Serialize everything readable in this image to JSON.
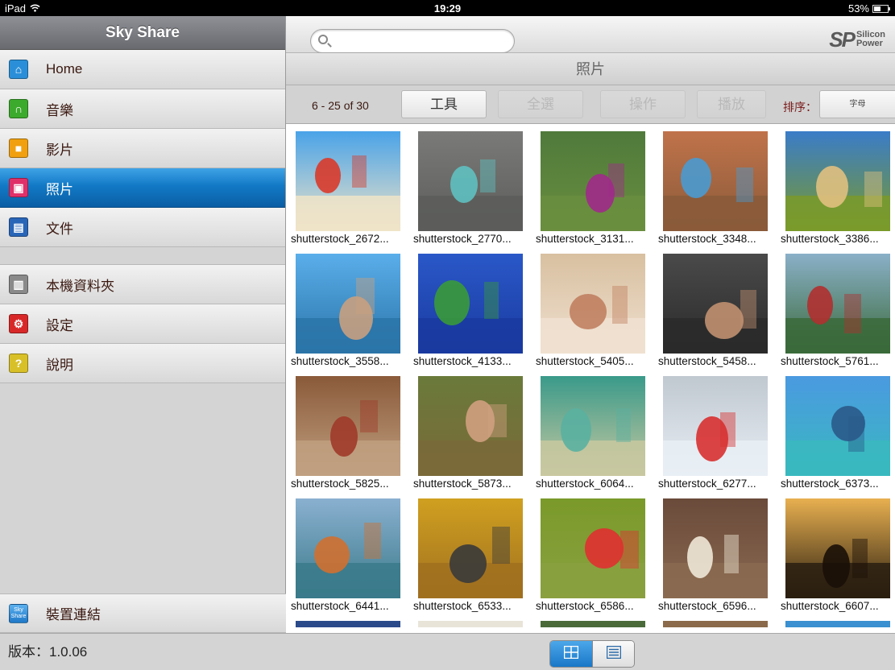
{
  "status_bar": {
    "device": "iPad",
    "time": "19:29",
    "battery": "53%",
    "battery_level": 0.53
  },
  "sidebar": {
    "title": "Sky Share",
    "items": [
      {
        "label": "Home",
        "icon": "home-icon",
        "color": "#2a8fd8",
        "glyph": "⌂"
      },
      {
        "label": "音樂",
        "icon": "headphones-icon",
        "color": "#3caa2c",
        "glyph": "∩"
      },
      {
        "label": "影片",
        "icon": "video-camera-icon",
        "color": "#f0a010",
        "glyph": "■"
      },
      {
        "label": "照片",
        "icon": "photo-icon",
        "color": "#e0306a",
        "glyph": "▣",
        "active": true
      },
      {
        "label": "文件",
        "icon": "document-icon",
        "color": "#2a66b8",
        "glyph": "▤"
      }
    ],
    "items2": [
      {
        "label": "本機資料夾",
        "icon": "local-folder-icon",
        "color": "#8a8a8a",
        "glyph": "▥"
      },
      {
        "label": "設定",
        "icon": "settings-gears-icon",
        "color": "#d82828",
        "glyph": "⚙"
      },
      {
        "label": "說明",
        "icon": "help-question-icon",
        "color": "#d8c028",
        "glyph": "?"
      }
    ],
    "device_link": {
      "label": "裝置連結",
      "icon": "sky-share-app-icon",
      "icon_text": "Sky Share"
    },
    "version": "版本：1.0.06"
  },
  "header": {
    "search_placeholder": "",
    "logo_mark": "SP",
    "logo_text_1": "Silicon",
    "logo_text_2": "Power",
    "section_title": "照片"
  },
  "toolbar": {
    "range": "6 - 25 of 30",
    "tools": "工具",
    "select_all": "全選",
    "operate": "操作",
    "play": "播放",
    "sort_label": "排序：",
    "sort_value": "字母"
  },
  "photos": [
    {
      "name": "shutterstock_2672...",
      "sky": "#4aa3e8",
      "ground": "#f0e4c8",
      "accent": "#d93a2a"
    },
    {
      "name": "shutterstock_2770...",
      "sky": "#7a7a78",
      "ground": "#5c5d5a",
      "accent": "#5fc0c0"
    },
    {
      "name": "shutterstock_3131...",
      "sky": "#4f7a3c",
      "ground": "#6a8e3e",
      "accent": "#a02a8a"
    },
    {
      "name": "shutterstock_3348...",
      "sky": "#c0734a",
      "ground": "#8a5a3a",
      "accent": "#4a9ad0"
    },
    {
      "name": "shutterstock_3386...",
      "sky": "#3a7cc8",
      "ground": "#7a9a2a",
      "accent": "#e0c080"
    },
    {
      "name": "shutterstock_3558...",
      "sky": "#5aaeea",
      "ground": "#2a74a8",
      "accent": "#c8a080"
    },
    {
      "name": "shutterstock_4133...",
      "sky": "#2a58c8",
      "ground": "#1a3aa0",
      "accent": "#3a9a3a"
    },
    {
      "name": "shutterstock_5405...",
      "sky": "#d8c0a0",
      "ground": "#f0e0d0",
      "accent": "#c08060"
    },
    {
      "name": "shutterstock_5458...",
      "sky": "#4a4a4a",
      "ground": "#2a2a2a",
      "accent": "#c09070"
    },
    {
      "name": "shutterstock_5761...",
      "sky": "#8ab0c8",
      "ground": "#3a6a3a",
      "accent": "#b03030"
    },
    {
      "name": "shutterstock_5825...",
      "sky": "#8a5a3a",
      "ground": "#c0a080",
      "accent": "#a03a2a"
    },
    {
      "name": "shutterstock_5873...",
      "sky": "#6a7a3a",
      "ground": "#7a6a3a",
      "accent": "#d0a080"
    },
    {
      "name": "shutterstock_6064...",
      "sky": "#3a9a8a",
      "ground": "#c8c8a0",
      "accent": "#5ab0a0"
    },
    {
      "name": "shutterstock_6277...",
      "sky": "#c0c8d0",
      "ground": "#e8eef4",
      "accent": "#d83030"
    },
    {
      "name": "shutterstock_6373...",
      "sky": "#4a9ae0",
      "ground": "#3ab8c0",
      "accent": "#2a5a8a"
    },
    {
      "name": "shutterstock_6441...",
      "sky": "#8ab0d0",
      "ground": "#3a7a8a",
      "accent": "#d07030"
    },
    {
      "name": "shutterstock_6533...",
      "sky": "#d0a020",
      "ground": "#a07020",
      "accent": "#3a3a3a"
    },
    {
      "name": "shutterstock_6586...",
      "sky": "#7a9a2a",
      "ground": "#8aa040",
      "accent": "#e03030"
    },
    {
      "name": "shutterstock_6596...",
      "sky": "#6a4a3a",
      "ground": "#8a6a50",
      "accent": "#f0e8d8"
    },
    {
      "name": "shutterstock_6607...",
      "sky": "#e8b050",
      "ground": "#2a1e10",
      "accent": "#1a1008"
    }
  ],
  "view_toggle": {
    "grid_icon": "grid-view-icon",
    "list_icon": "list-view-icon"
  }
}
